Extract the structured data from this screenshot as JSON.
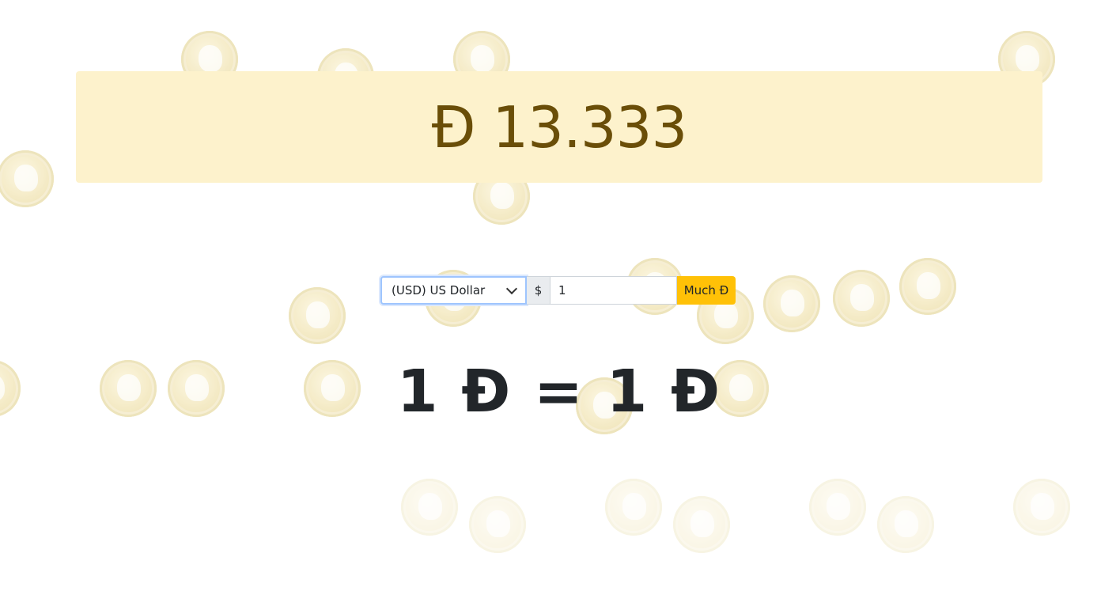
{
  "banner": {
    "rate_value": "Đ 13.333"
  },
  "converter": {
    "selected_currency": "(USD) US Dollar",
    "currency_symbol": "$",
    "amount_value": "1",
    "submit_label": "Much Đ"
  },
  "result": {
    "equation": "1 Đ = 1 Đ"
  },
  "colors": {
    "banner_background": "#fdf2cc",
    "banner_text": "#6a4e08",
    "button_accent": "#ffc107"
  },
  "background": {
    "decoration_icon": "dogecoin-coin-icon"
  }
}
